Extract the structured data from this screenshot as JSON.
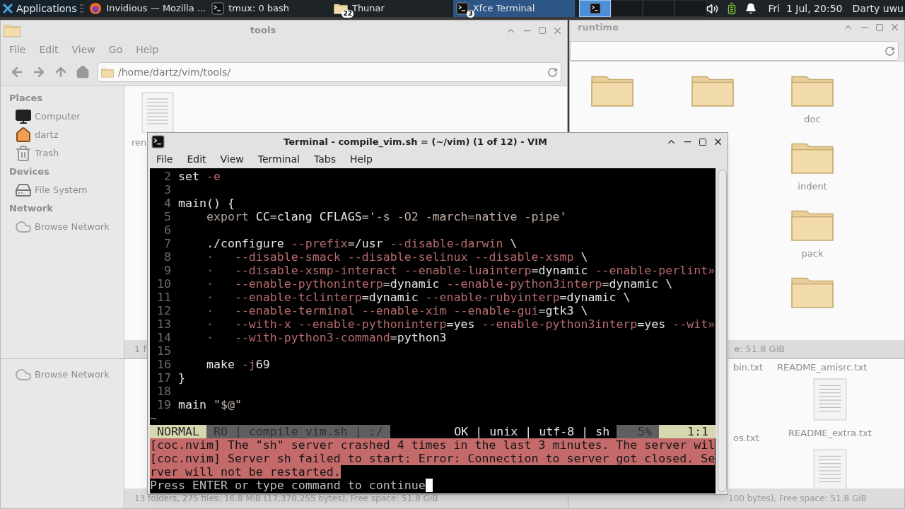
{
  "taskbar": {
    "apps_menu": "Applications",
    "tasks": [
      {
        "label": "Invidious — Mozilla ...",
        "kind": "browser",
        "selected": false
      },
      {
        "label": "tmux: 0 bash",
        "kind": "terminal",
        "selected": false
      },
      {
        "label": "Thunar",
        "kind": "folder",
        "badge": "22",
        "selected": false
      },
      {
        "label": "Xfce Terminal",
        "kind": "terminal",
        "badge": "3",
        "selected": true
      }
    ],
    "workspaces": [
      {
        "selected": true
      },
      {
        "selected": false
      },
      {
        "selected": false
      },
      {
        "selected": false
      }
    ],
    "clock": "Fri  1 Jul, 20:50",
    "user": "Darty uwu"
  },
  "tools_window": {
    "title": "tools",
    "menu": [
      "File",
      "Edit",
      "View",
      "Go",
      "Help"
    ],
    "path": "/home/dartz/vim/tools/",
    "sidebar": [
      {
        "heading": "Places",
        "items": [
          {
            "label": "Computer",
            "kind": "computer"
          },
          {
            "label": "dartz",
            "kind": "home"
          },
          {
            "label": "Trash",
            "kind": "trash"
          }
        ]
      },
      {
        "heading": "Devices",
        "items": [
          {
            "label": "File System",
            "kind": "drive"
          }
        ]
      },
      {
        "heading": "Network",
        "items": [
          {
            "label": "Browse Network",
            "kind": "network"
          }
        ]
      }
    ],
    "file": {
      "label": "ren"
    },
    "status": "1 f"
  },
  "runtime_window": {
    "title": "runtime",
    "folders": [
      {
        "kind": "folder"
      },
      {
        "kind": "folder"
      },
      {
        "kind": "folder",
        "label": "doc"
      },
      {
        "kind": "empty"
      },
      {
        "kind": "empty"
      },
      {
        "kind": "folder",
        "label": "indent"
      },
      {
        "kind": "empty"
      },
      {
        "kind": "empty"
      },
      {
        "kind": "folder",
        "label": "pack"
      },
      {
        "kind": "empty"
      },
      {
        "kind": "empty"
      },
      {
        "kind": "folder"
      }
    ],
    "status": "e: 51.8 GiB"
  },
  "back_left_window": {
    "sidebar_item": "Browse Network",
    "status": "13 folders, 275 files: 16.8 MiB (17,370,255 bytes), Free space: 51.8 GiB"
  },
  "back_right_window": {
    "files": [
      {
        "kind": "label",
        "label": "bin.txt"
      },
      {
        "kind": "label",
        "label": "README_amisrc.txt"
      },
      {
        "kind": "label",
        "label": "os.txt"
      },
      {
        "kind": "document",
        "label": "README_extra.txt"
      },
      {
        "kind": "empty"
      },
      {
        "kind": "document"
      }
    ],
    "status": "100 bytes), Free space: 51.8 GiB"
  },
  "terminal": {
    "title": "Terminal - compile_vim.sh = (~/vim) (1 of 12) - VIM",
    "menu": [
      "File",
      "Edit",
      "View",
      "Terminal",
      "Tabs",
      "Help"
    ],
    "lines": [
      {
        "number": "2",
        "tokens": [
          {
            "kind": "plain",
            "text": "set "
          },
          {
            "kind": "flag",
            "text": "-e"
          }
        ]
      },
      {
        "number": "3"
      },
      {
        "number": "4",
        "tokens": [
          {
            "kind": "plain",
            "text": "main() {"
          }
        ]
      },
      {
        "number": "5",
        "tokens": [
          {
            "kind": "keyword",
            "text": "    export"
          },
          {
            "kind": "plain",
            "text": " CC=clang CFLAGS="
          },
          {
            "kind": "string",
            "text": "'-s -O2 -march=native -pipe'"
          }
        ]
      },
      {
        "number": "6"
      },
      {
        "number": "7",
        "tokens": [
          {
            "kind": "plain",
            "text": "    ./configure "
          },
          {
            "kind": "flag",
            "text": "--prefix"
          },
          {
            "kind": "plain",
            "text": "=/usr "
          },
          {
            "kind": "flag",
            "text": "--disable-darwin"
          },
          {
            "kind": "plain",
            "text": " \\"
          }
        ]
      },
      {
        "number": "8",
        "tokens": [
          {
            "kind": "guide",
            "text": "    ·   "
          },
          {
            "kind": "flag",
            "text": "--disable-smack --disable-selinux --disable-xsmp"
          },
          {
            "kind": "plain",
            "text": " \\"
          }
        ]
      },
      {
        "number": "9",
        "tokens": [
          {
            "kind": "guide",
            "text": "    ·   "
          },
          {
            "kind": "flag",
            "text": "--disable-xsmp-interact --enable-luainterp"
          },
          {
            "kind": "plain",
            "text": "=dynamic "
          },
          {
            "kind": "flag",
            "text": "--enable-perlint»"
          }
        ]
      },
      {
        "number": "10",
        "tokens": [
          {
            "kind": "guide",
            "text": "    ·   "
          },
          {
            "kind": "flag",
            "text": "--enable-pythoninterp"
          },
          {
            "kind": "plain",
            "text": "=dynamic "
          },
          {
            "kind": "flag",
            "text": "--enable-python3interp"
          },
          {
            "kind": "plain",
            "text": "=dynamic \\"
          }
        ]
      },
      {
        "number": "11",
        "tokens": [
          {
            "kind": "guide",
            "text": "    ·   "
          },
          {
            "kind": "flag",
            "text": "--enable-tclinterp"
          },
          {
            "kind": "plain",
            "text": "=dynamic "
          },
          {
            "kind": "flag",
            "text": "--enable-rubyinterp"
          },
          {
            "kind": "plain",
            "text": "=dynamic \\"
          }
        ]
      },
      {
        "number": "12",
        "tokens": [
          {
            "kind": "guide",
            "text": "    ·   "
          },
          {
            "kind": "flag",
            "text": "--enable-terminal --enable-xim --enable-gui"
          },
          {
            "kind": "plain",
            "text": "=gtk3 \\"
          }
        ]
      },
      {
        "number": "13",
        "tokens": [
          {
            "kind": "guide",
            "text": "    ·   "
          },
          {
            "kind": "flag",
            "text": "--with-x --enable-pythoninterp"
          },
          {
            "kind": "plain",
            "text": "=yes "
          },
          {
            "kind": "flag",
            "text": "--enable-python3interp"
          },
          {
            "kind": "plain",
            "text": "=yes "
          },
          {
            "kind": "flag",
            "text": "--wit»"
          }
        ]
      },
      {
        "number": "14",
        "tokens": [
          {
            "kind": "guide",
            "text": "    ·   "
          },
          {
            "kind": "flag",
            "text": "--with-python3-command"
          },
          {
            "kind": "plain",
            "text": "=python3"
          }
        ]
      },
      {
        "number": "15"
      },
      {
        "number": "16",
        "tokens": [
          {
            "kind": "plain",
            "text": "    make "
          },
          {
            "kind": "flag",
            "text": "-j"
          },
          {
            "kind": "plain",
            "text": "69"
          }
        ]
      },
      {
        "number": "17",
        "tokens": [
          {
            "kind": "plain",
            "text": "}"
          }
        ]
      },
      {
        "number": "18"
      },
      {
        "number": "19",
        "tokens": [
          {
            "kind": "plain",
            "text": "main "
          },
          {
            "kind": "string",
            "text": "\"$@\""
          }
        ]
      }
    ],
    "end_marker": "~",
    "statusline": {
      "mode": "NORMAL",
      "file_info": "RO | compile_vim.sh | :/",
      "file_format": "OK | unix | utf-8 | sh",
      "percent": "5%",
      "position": "1:1"
    },
    "messages": [
      {
        "kind": "error",
        "text": "[coc.nvim] The \"sh\" server crashed 4 times in the last 3 minutes. The server wil"
      },
      {
        "kind": "error",
        "text": "[coc.nvim] Server sh failed to start: Error: Connection to server got closed. Se"
      },
      {
        "kind": "error",
        "text": "rver will not be restarted."
      }
    ],
    "prompt": "Press ENTER or type command to continue"
  }
}
